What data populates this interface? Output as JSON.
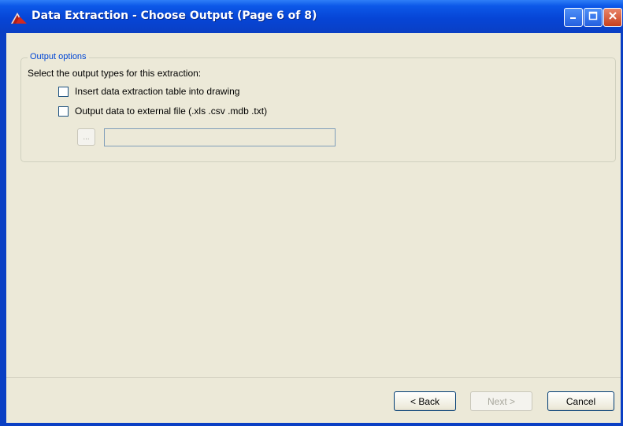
{
  "window": {
    "title": "Data Extraction - Choose Output (Page 6 of 8)"
  },
  "output_options": {
    "legend": "Output options",
    "prompt": "Select the output types for this extraction:",
    "options": [
      {
        "label": "Insert data extraction table into drawing",
        "checked": false
      },
      {
        "label": "Output data to external file (.xls .csv .mdb .txt)",
        "checked": false
      }
    ],
    "browse_label": "...",
    "file_path_value": ""
  },
  "footer": {
    "back_label": "< Back",
    "next_label": "Next >",
    "cancel_label": "Cancel"
  },
  "colors": {
    "titlebar": "#0a3fc4",
    "dialog_bg": "#ece9d8",
    "legend_text": "#0046d5",
    "close_button": "#c8401d"
  }
}
